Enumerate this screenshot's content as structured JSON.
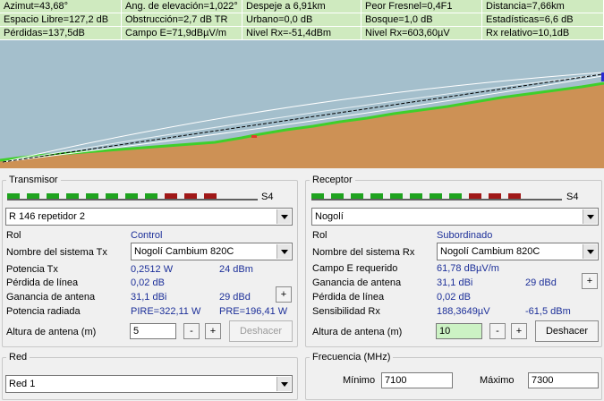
{
  "stats": {
    "row1": [
      "Azimut=43,68°",
      "Ang. de elevación=1,022°",
      "Despeje a 6,91km",
      "Peor Fresnel=0,4F1",
      "Distancia=7,66km"
    ],
    "row2": [
      "Espacio Libre=127,2 dB",
      "Obstrucción=2,7 dB TR",
      "Urbano=0,0 dB",
      "Bosque=1,0 dB",
      "Estadísticas=6,6 dB"
    ],
    "row3": [
      "Pérdidas=137,5dB",
      "Campo E=71,9dBµV/m",
      "Nivel Rx=-51,4dBm",
      "Nivel Rx=603,60µV",
      "Rx relativo=10,1dB"
    ]
  },
  "colors": {
    "stats_bg": "#cfeabf",
    "sky": "#a4bfcc",
    "terrain": "#cd9155",
    "vegetation": "#3fcf2b",
    "meter_green": "#1fa31f",
    "meter_red": "#a01818",
    "value_blue": "#1c2f99"
  },
  "tx": {
    "title": "Transmisor",
    "signal_label": "S4",
    "meter": {
      "green_segments": 8,
      "red_segments": 3
    },
    "station": "R 146 repetidor 2",
    "rol_label": "Rol",
    "rol_value": "Control",
    "system_label": "Nombre del sistema Tx",
    "system_value": "Nogolí Cambium 820C",
    "power_label": "Potencia Tx",
    "power_w": "0,2512 W",
    "power_dbm": "24 dBm",
    "line_loss_label": "Pérdida de línea",
    "line_loss_value": "0,02 dB",
    "gain_label": "Ganancia de antena",
    "gain_dbi": "31,1 dBi",
    "gain_dbd": "29 dBd",
    "plus_label": "+",
    "radiated_label": "Potencia radiada",
    "pire": "PIRE=322,11 W",
    "pre": "PRE=196,41 W",
    "height_label": "Altura de antena (m)",
    "height_value": "5",
    "minus_label": "-",
    "undo_label": "Deshacer"
  },
  "rx": {
    "title": "Receptor",
    "signal_label": "S4",
    "meter": {
      "green_segments": 8,
      "red_segments": 3
    },
    "station": "Nogolí",
    "rol_label": "Rol",
    "rol_value": "Subordinado",
    "system_label": "Nombre del sistema Rx",
    "system_value": "Nogolí Cambium 820C",
    "field_label": "Campo E requerido",
    "field_value": "61,78 dBµV/m",
    "gain_label": "Ganancia de antena",
    "gain_dbi": "31,1 dBi",
    "gain_dbd": "29 dBd",
    "plus_label": "+",
    "line_loss_label": "Pérdida de línea",
    "line_loss_value": "0,02 dB",
    "sens_label": "Sensibilidad Rx",
    "sens_uv": "188,3649µV",
    "sens_dbm": "-61,5 dBm",
    "height_label": "Altura de antena (m)",
    "height_value": "10",
    "minus_label": "-",
    "undo_label": "Deshacer"
  },
  "net": {
    "title": "Red",
    "value": "Red  1"
  },
  "freq": {
    "title": "Frecuencia (MHz)",
    "min_label": "Mínimo",
    "min_value": "7100",
    "max_label": "Máximo",
    "max_value": "7300"
  }
}
